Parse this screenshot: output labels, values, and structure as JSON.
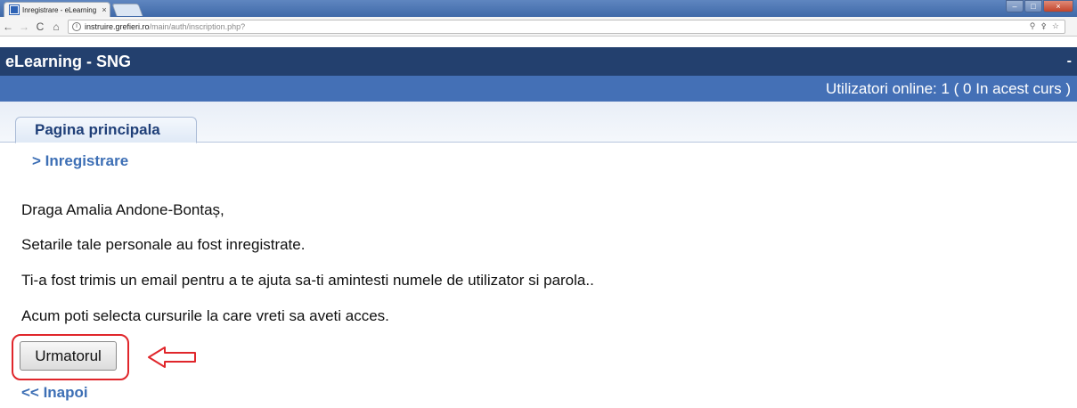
{
  "browser": {
    "tab_title": "Inregistrare - eLearning",
    "tab_close": "×",
    "nav_back": "←",
    "nav_forward": "→",
    "nav_reload": "C",
    "nav_home": "⌂",
    "url_host": "instruire.grefieri.ro",
    "url_path": "/main/auth/inscription.php?",
    "window_controls": [
      "–",
      "□",
      "×"
    ]
  },
  "header": {
    "site_title": "eLearning - SNG",
    "right_text": "-"
  },
  "online_bar": {
    "text": "Utilizatori online:  1  ( 0 In acest curs  )"
  },
  "tabs": {
    "main_tab_label": "Pagina principala"
  },
  "breadcrumb": {
    "text": "> Inregistrare"
  },
  "messages": {
    "greeting": "Draga Amalia Andone-Bontaș,",
    "saved": "Setarile tale personale au fost inregistrate.",
    "email_sent": "Ti-a fost trimis un email pentru a te ajuta sa-ti amintesti numele de utilizator si parola..",
    "select_courses": "Acum poti selecta cursurile la care vreti sa aveti acces."
  },
  "actions": {
    "next_label": "Urmatorul",
    "back_label": "<< Inapoi"
  },
  "colors": {
    "header_bg": "#23406e",
    "online_bar_bg": "#4470b6",
    "link": "#3d6fb5",
    "annotation_red": "#e0262b"
  }
}
